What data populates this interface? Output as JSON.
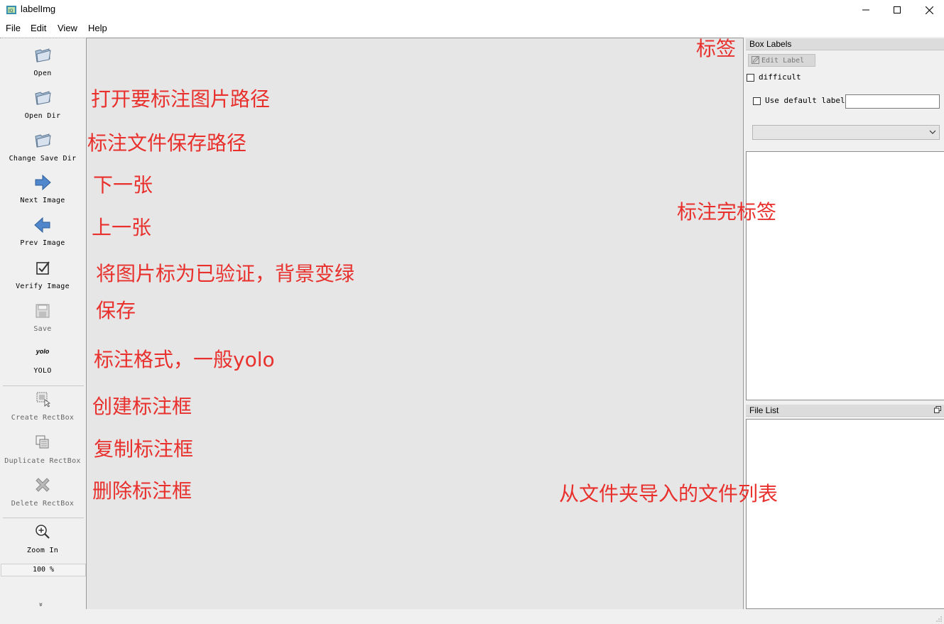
{
  "window": {
    "title": "labelImg",
    "icon": "labelimg-app-icon"
  },
  "menu": [
    "File",
    "Edit",
    "View",
    "Help"
  ],
  "toolbar": {
    "items": [
      {
        "label": "Open",
        "icon": "open-folder-icon"
      },
      {
        "label": "Open Dir",
        "icon": "open-dir-folder-icon"
      },
      {
        "label": "Change Save Dir",
        "icon": "save-dir-folder-icon"
      },
      {
        "label": "Next Image",
        "icon": "arrow-right-icon"
      },
      {
        "label": "Prev Image",
        "icon": "arrow-left-icon"
      },
      {
        "label": "Verify Image",
        "icon": "checkbox-icon"
      },
      {
        "label": "Save",
        "icon": "floppy-disk-icon"
      },
      {
        "label": "YOLO",
        "icon": "yolo-icon",
        "icon_text": "yolo"
      },
      {
        "label": "Create RectBox",
        "icon": "create-rectbox-icon"
      },
      {
        "label": "Duplicate RectBox",
        "icon": "duplicate-rectbox-icon"
      },
      {
        "label": "Delete RectBox",
        "icon": "delete-x-icon"
      },
      {
        "label": "Zoom In",
        "icon": "zoom-in-icon"
      }
    ],
    "zoom_value": "100 %",
    "more_glyph": "»"
  },
  "dock": {
    "box_labels_title": "Box Labels",
    "edit_label_button": "Edit Label",
    "difficult_label": "difficult",
    "difficult_checked": false,
    "use_default_label": "Use default label",
    "use_default_checked": false,
    "default_label_value": "",
    "label_combo_value": "",
    "file_list_title": "File List"
  },
  "annotations": {
    "labels": "标签",
    "open_path": "打开要标注图片路径",
    "save_path": "标注文件保存路径",
    "next": "下一张",
    "prev": "上一张",
    "verify": "将图片标为已验证，背景变绿",
    "save": "保存",
    "format": "标注格式，一般yolo",
    "create": "创建标注框",
    "duplicate": "复制标注框",
    "delete": "删除标注框",
    "done_labels": "标注完标签",
    "file_list": "从文件夹导入的文件列表"
  },
  "colors": {
    "annotation": "#e8302d",
    "canvas": "#e6e6e6"
  }
}
